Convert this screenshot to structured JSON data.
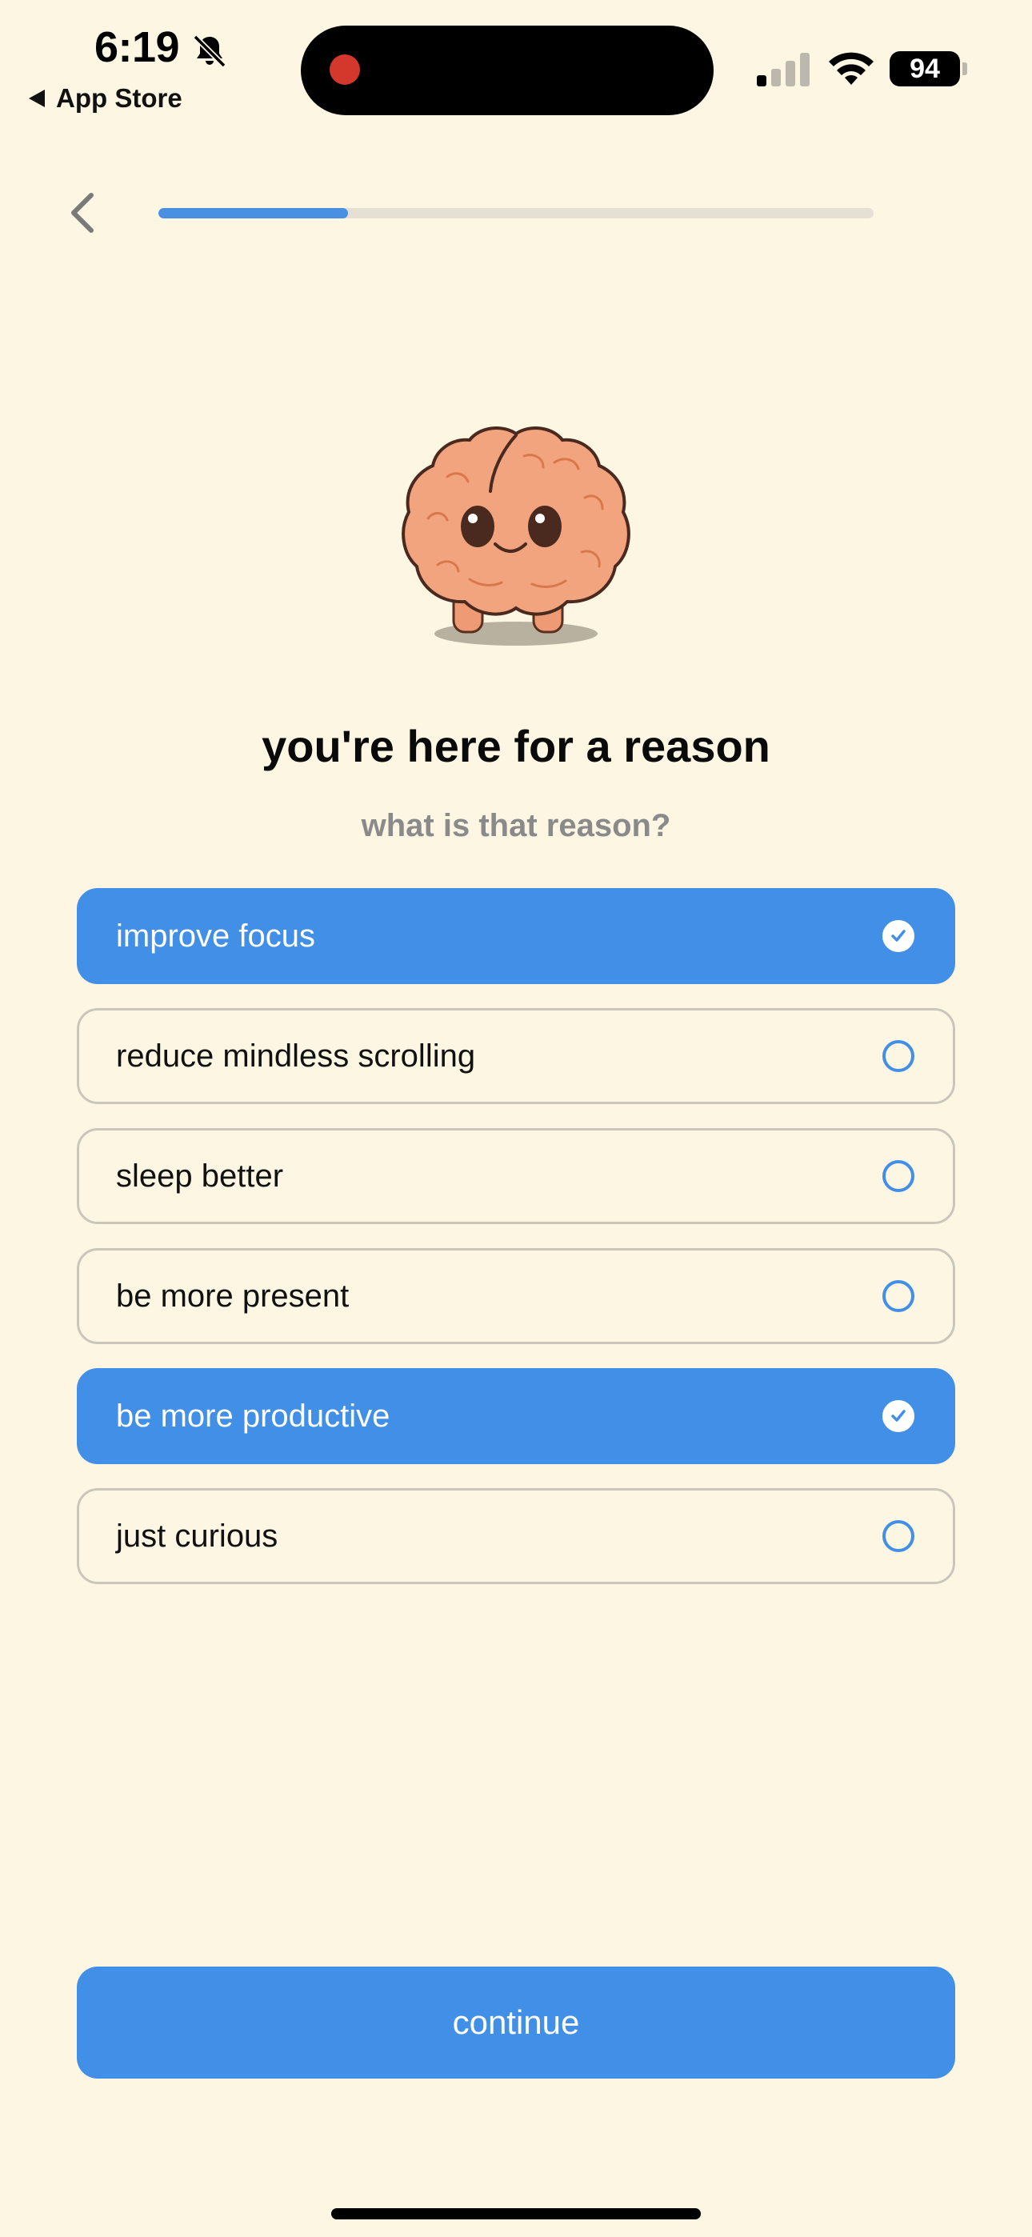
{
  "status_bar": {
    "time": "6:19",
    "back_app": "App Store",
    "battery": "94"
  },
  "header": {
    "progress_fraction": 0.265
  },
  "question": {
    "title": "you're here for a reason",
    "subtitle": "what is that reason?"
  },
  "options": [
    {
      "label": "improve focus",
      "selected": true
    },
    {
      "label": "reduce mindless scrolling",
      "selected": false
    },
    {
      "label": "sleep better",
      "selected": false
    },
    {
      "label": "be more present",
      "selected": false
    },
    {
      "label": "be more productive",
      "selected": true
    },
    {
      "label": "just curious",
      "selected": false
    }
  ],
  "continue_label": "continue",
  "colors": {
    "background": "#FDF6E3",
    "accent": "#418FE6",
    "progress_track": "#E6E0D4",
    "recording_dot": "#D4372C"
  }
}
